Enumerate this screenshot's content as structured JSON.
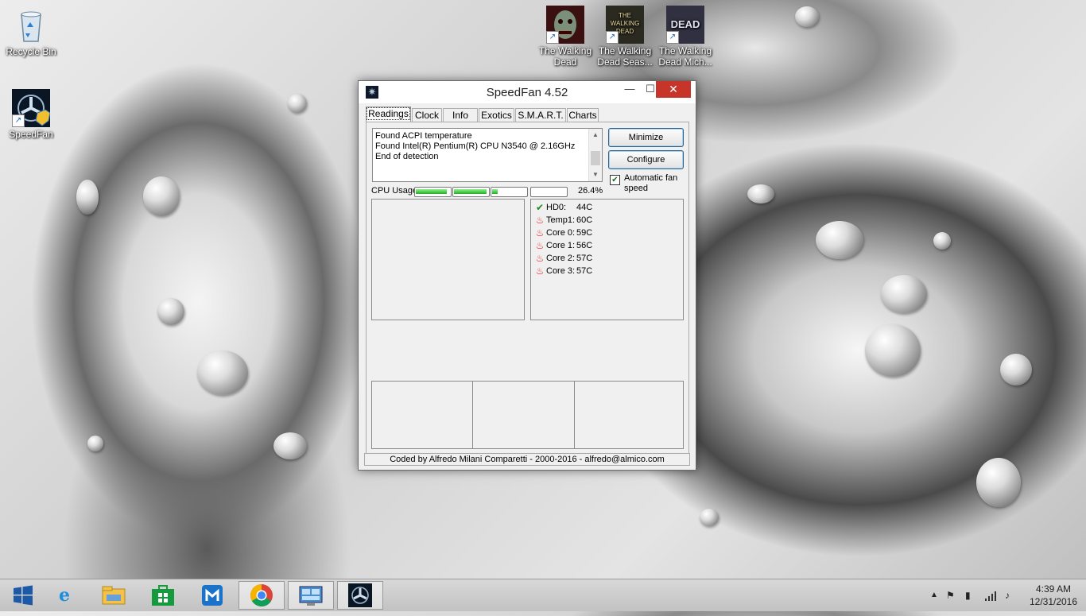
{
  "desktop": {
    "icons": [
      {
        "label": "Recycle Bin"
      },
      {
        "label": "SpeedFan"
      },
      {
        "label": "The Walking Dead"
      },
      {
        "label": "The Walking Dead Seas..."
      },
      {
        "label": "The Walking Dead Mich..."
      }
    ],
    "game_art": [
      "THE WALKING DEAD",
      "THE WALKING DEAD",
      "DEAD"
    ]
  },
  "window": {
    "title": "SpeedFan 4.52",
    "controls": {
      "minimize": "—",
      "maximize": "☐",
      "close": "✕"
    },
    "tabs": [
      "Readings",
      "Clock",
      "Info",
      "Exotics",
      "S.M.A.R.T.",
      "Charts"
    ],
    "active_tab": "Readings",
    "log_lines": [
      "Found ACPI temperature",
      "Found Intel(R) Pentium(R) CPU N3540 @ 2.16GHz",
      "End of detection"
    ],
    "buttons": {
      "minimize": "Minimize",
      "configure": "Configure"
    },
    "automatic_fan_speed": {
      "label": "Automatic fan speed",
      "checked": true
    },
    "cpu_usage": {
      "label": "CPU Usage",
      "percent_text": "26.4%",
      "core_levels": [
        0.95,
        1.0,
        0.18,
        0.0
      ]
    },
    "readings": [
      {
        "name": "HD0:",
        "value": "44C",
        "icon": "check-icon"
      },
      {
        "name": "Temp1:",
        "value": "60C",
        "icon": "flame-icon"
      },
      {
        "name": "Core 0:",
        "value": "59C",
        "icon": "flame-icon"
      },
      {
        "name": "Core 1:",
        "value": "56C",
        "icon": "flame-icon"
      },
      {
        "name": "Core 2:",
        "value": "57C",
        "icon": "flame-icon"
      },
      {
        "name": "Core 3:",
        "value": "57C",
        "icon": "flame-icon"
      }
    ],
    "status": "Coded by Alfredo Milani Comparetti - 2000-2016 - alfredo@almico.com"
  },
  "taskbar": {
    "apps": [
      "start",
      "internet-explorer",
      "file-explorer",
      "store",
      "maxthon",
      "chrome",
      "control-panel",
      "speedfan"
    ],
    "clock": {
      "time": "4:39 AM",
      "date": "12/31/2016"
    },
    "tray_icons": [
      "show-hidden-icons",
      "flag-icon",
      "battery-icon",
      "network-icon",
      "volume-icon"
    ]
  }
}
